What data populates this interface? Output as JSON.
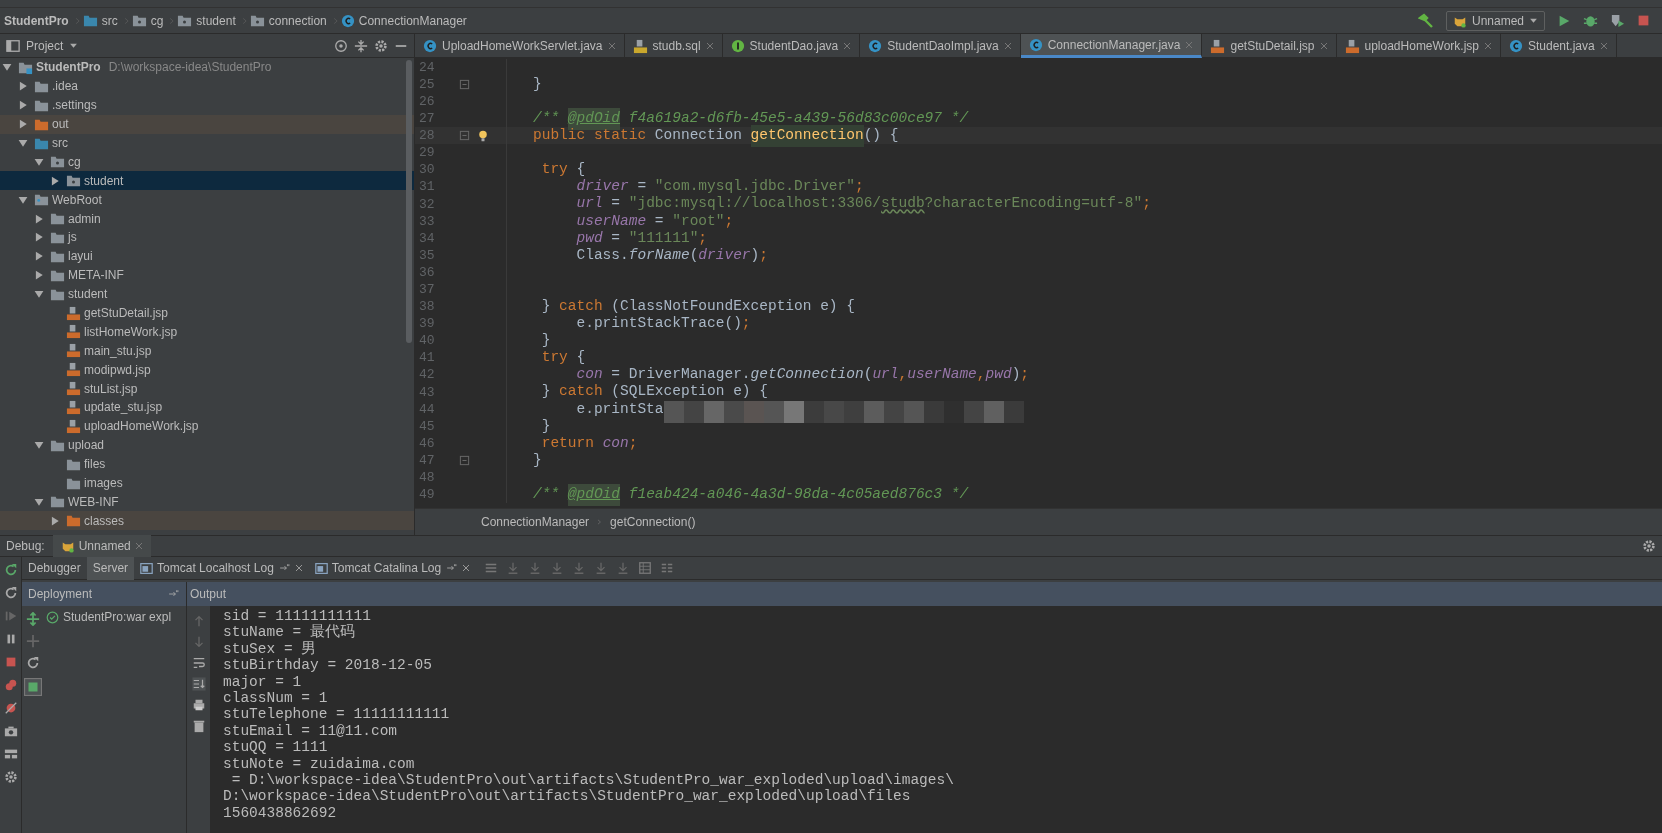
{
  "breadcrumbs": [
    {
      "label": "StudentPro",
      "kind": "module"
    },
    {
      "label": "src",
      "kind": "source"
    },
    {
      "label": "cg",
      "kind": "package"
    },
    {
      "label": "student",
      "kind": "package"
    },
    {
      "label": "connection",
      "kind": "package"
    },
    {
      "label": "ConnectionManager",
      "kind": "class"
    }
  ],
  "run_config": {
    "label": "Unnamed"
  },
  "project_panel": {
    "title": "Project"
  },
  "tabs": [
    {
      "label": "UploadHomeWorkServlet.java",
      "kind": "class",
      "selected": false
    },
    {
      "label": "studb.sql",
      "kind": "sql",
      "selected": false
    },
    {
      "label": "StudentDao.java",
      "kind": "interface",
      "selected": false
    },
    {
      "label": "StudentDaoImpl.java",
      "kind": "class",
      "selected": false
    },
    {
      "label": "ConnectionManager.java",
      "kind": "class",
      "selected": true
    },
    {
      "label": "getStuDetail.jsp",
      "kind": "jsp",
      "selected": false
    },
    {
      "label": "uploadHomeWork.jsp",
      "kind": "jsp",
      "selected": false
    },
    {
      "label": "Student.java",
      "kind": "class",
      "selected": false
    }
  ],
  "tree": [
    {
      "label": "StudentPro",
      "path": "D:\\workspace-idea\\StudentPro",
      "kind": "module",
      "expandable": true,
      "expanded": true,
      "selected": false,
      "children": [
        {
          "label": ".idea",
          "kind": "folder",
          "expandable": true,
          "expanded": false,
          "selected": false
        },
        {
          "label": ".settings",
          "kind": "folder",
          "expandable": true,
          "expanded": false,
          "selected": false
        },
        {
          "label": "out",
          "kind": "excluded",
          "expandable": true,
          "expanded": false,
          "selected": false
        },
        {
          "label": "src",
          "kind": "source",
          "expandable": true,
          "expanded": true,
          "selected": false,
          "children": [
            {
              "label": "cg",
              "kind": "package",
              "expandable": true,
              "expanded": true,
              "selected": false,
              "children": [
                {
                  "label": "student",
                  "kind": "package",
                  "expandable": true,
                  "expanded": false,
                  "selected": true
                }
              ]
            }
          ]
        },
        {
          "label": "WebRoot",
          "kind": "webroot",
          "expandable": true,
          "expanded": true,
          "selected": false,
          "children": [
            {
              "label": "admin",
              "kind": "folder",
              "expandable": true,
              "expanded": false,
              "selected": false
            },
            {
              "label": "js",
              "kind": "folder",
              "expandable": true,
              "expanded": false,
              "selected": false
            },
            {
              "label": "layui",
              "kind": "folder",
              "expandable": true,
              "expanded": false,
              "selected": false
            },
            {
              "label": "META-INF",
              "kind": "folder",
              "expandable": true,
              "expanded": false,
              "selected": false
            },
            {
              "label": "student",
              "kind": "folder",
              "expandable": true,
              "expanded": true,
              "selected": false,
              "children": [
                {
                  "label": "getStuDetail.jsp",
                  "kind": "jsp",
                  "expandable": false,
                  "selected": false
                },
                {
                  "label": "listHomeWork.jsp",
                  "kind": "jsp",
                  "expandable": false,
                  "selected": false
                },
                {
                  "label": "main_stu.jsp",
                  "kind": "jsp",
                  "expandable": false,
                  "selected": false
                },
                {
                  "label": "modipwd.jsp",
                  "kind": "jsp",
                  "expandable": false,
                  "selected": false
                },
                {
                  "label": "stuList.jsp",
                  "kind": "jsp",
                  "expandable": false,
                  "selected": false
                },
                {
                  "label": "update_stu.jsp",
                  "kind": "jsp",
                  "expandable": false,
                  "selected": false
                },
                {
                  "label": "uploadHomeWork.jsp",
                  "kind": "jsp",
                  "expandable": false,
                  "selected": false
                }
              ]
            },
            {
              "label": "upload",
              "kind": "folder",
              "expandable": true,
              "expanded": true,
              "selected": false,
              "children": [
                {
                  "label": "files",
                  "kind": "folder",
                  "expandable": false,
                  "selected": false
                },
                {
                  "label": "images",
                  "kind": "folder",
                  "expandable": false,
                  "selected": false
                }
              ]
            },
            {
              "label": "WEB-INF",
              "kind": "folder",
              "expandable": true,
              "expanded": true,
              "selected": false,
              "children": [
                {
                  "label": "classes",
                  "kind": "excluded",
                  "expandable": true,
                  "expanded": false,
                  "selected": false
                }
              ]
            }
          ]
        }
      ]
    }
  ],
  "code_lines": [
    {
      "number": "24",
      "fold": false,
      "current": false
    },
    {
      "number": "25",
      "fold": true,
      "current": false,
      "tokens": [
        {
          "kind": "plain",
          "text": "}"
        }
      ]
    },
    {
      "number": "26",
      "fold": false,
      "current": false
    },
    {
      "number": "27",
      "fold": false,
      "current": false,
      "tokens": [
        {
          "kind": "comment",
          "text": "/** "
        },
        {
          "kind": "doctag",
          "text": "@pdOid"
        },
        {
          "kind": "comment",
          "text": " f4a619a2-d6fb-45e5-a439-56d83c00ce97 */"
        }
      ]
    },
    {
      "number": "28",
      "fold": true,
      "current": true,
      "tokens": [
        {
          "kind": "keyword",
          "text": "public static "
        },
        {
          "kind": "plain",
          "text": "Connection "
        },
        {
          "kind": "declaration",
          "text": "getConnection"
        },
        {
          "kind": "plain",
          "text": "() {"
        }
      ]
    },
    {
      "number": "29",
      "fold": false,
      "current": false
    },
    {
      "number": "30",
      "fold": false,
      "current": false,
      "tokens": [
        {
          "kind": "keyword",
          "text": " try "
        },
        {
          "kind": "plain",
          "text": "{"
        }
      ]
    },
    {
      "number": "31",
      "fold": false,
      "current": false,
      "tokens": [
        {
          "kind": "field",
          "text": "     driver"
        },
        {
          "kind": "plain",
          "text": " = "
        },
        {
          "kind": "string",
          "text": "\"com.mysql.jdbc.Driver\""
        },
        {
          "kind": "keyword",
          "text": ";"
        }
      ]
    },
    {
      "number": "32",
      "fold": false,
      "current": false,
      "tokens": [
        {
          "kind": "field",
          "text": "     url"
        },
        {
          "kind": "plain",
          "text": " = "
        },
        {
          "kind": "string",
          "text": "\"jdbc:mysql://localhost:3306/"
        },
        {
          "kind": "typo",
          "text": "studb"
        },
        {
          "kind": "string",
          "text": "?characterEncoding=utf-8\""
        },
        {
          "kind": "keyword",
          "text": ";"
        }
      ]
    },
    {
      "number": "33",
      "fold": false,
      "current": false,
      "tokens": [
        {
          "kind": "field",
          "text": "     userName"
        },
        {
          "kind": "plain",
          "text": " = "
        },
        {
          "kind": "string",
          "text": "\"root\""
        },
        {
          "kind": "keyword",
          "text": ";"
        }
      ]
    },
    {
      "number": "34",
      "fold": false,
      "current": false,
      "tokens": [
        {
          "kind": "field",
          "text": "     pwd"
        },
        {
          "kind": "plain",
          "text": " = "
        },
        {
          "kind": "string",
          "text": "\"111111\""
        },
        {
          "kind": "keyword",
          "text": ";"
        }
      ]
    },
    {
      "number": "35",
      "fold": false,
      "current": false,
      "tokens": [
        {
          "kind": "plain",
          "text": "     Class."
        },
        {
          "kind": "method",
          "text": "forName"
        },
        {
          "kind": "plain",
          "text": "("
        },
        {
          "kind": "field",
          "text": "driver"
        },
        {
          "kind": "plain",
          "text": ")"
        },
        {
          "kind": "keyword",
          "text": ";"
        }
      ]
    },
    {
      "number": "36",
      "fold": false,
      "current": false
    },
    {
      "number": "37",
      "fold": false,
      "current": false
    },
    {
      "number": "38",
      "fold": false,
      "current": false,
      "tokens": [
        {
          "kind": "plain",
          "text": " } "
        },
        {
          "kind": "keyword",
          "text": "catch "
        },
        {
          "kind": "plain",
          "text": "(ClassNotFoundException e) {"
        }
      ]
    },
    {
      "number": "39",
      "fold": false,
      "current": false,
      "tokens": [
        {
          "kind": "plain",
          "text": "     e.printStackTrace()"
        },
        {
          "kind": "keyword",
          "text": ";"
        }
      ]
    },
    {
      "number": "40",
      "fold": false,
      "current": false,
      "tokens": [
        {
          "kind": "plain",
          "text": " }"
        }
      ]
    },
    {
      "number": "41",
      "fold": false,
      "current": false,
      "tokens": [
        {
          "kind": "keyword",
          "text": " try "
        },
        {
          "kind": "plain",
          "text": "{"
        }
      ]
    },
    {
      "number": "42",
      "fold": false,
      "current": false,
      "tokens": [
        {
          "kind": "field",
          "text": "     con"
        },
        {
          "kind": "plain",
          "text": " = DriverManager."
        },
        {
          "kind": "method",
          "text": "getConnection"
        },
        {
          "kind": "plain",
          "text": "("
        },
        {
          "kind": "field",
          "text": "url"
        },
        {
          "kind": "keyword",
          "text": ","
        },
        {
          "kind": "field",
          "text": "userName"
        },
        {
          "kind": "keyword",
          "text": ","
        },
        {
          "kind": "field",
          "text": "pwd"
        },
        {
          "kind": "plain",
          "text": ")"
        },
        {
          "kind": "keyword",
          "text": ";"
        }
      ]
    },
    {
      "number": "43",
      "fold": false,
      "current": false,
      "tokens": [
        {
          "kind": "plain",
          "text": " } "
        },
        {
          "kind": "keyword",
          "text": "catch "
        },
        {
          "kind": "plain",
          "text": "(SQLException e) {"
        }
      ]
    },
    {
      "number": "44",
      "fold": false,
      "current": false,
      "tokens": [
        {
          "kind": "plain",
          "text": "     e.printSta"
        },
        {
          "kind": "redacted"
        }
      ]
    },
    {
      "number": "45",
      "fold": false,
      "current": false,
      "tokens": [
        {
          "kind": "plain",
          "text": " }"
        }
      ]
    },
    {
      "number": "46",
      "fold": false,
      "current": false,
      "tokens": [
        {
          "kind": "keyword",
          "text": " return "
        },
        {
          "kind": "field",
          "text": "con"
        },
        {
          "kind": "keyword",
          "text": ";"
        }
      ]
    },
    {
      "number": "47",
      "fold": true,
      "current": false,
      "tokens": [
        {
          "kind": "plain",
          "text": "}"
        }
      ]
    },
    {
      "number": "48",
      "fold": false,
      "current": false
    },
    {
      "number": "49",
      "fold": false,
      "current": false,
      "tokens": [
        {
          "kind": "comment",
          "text": "/** "
        },
        {
          "kind": "doctag",
          "text": "@pdOid"
        },
        {
          "kind": "comment",
          "text": " f1eab424-a046-4a3d-98da-4c05aed876c3 */"
        }
      ]
    }
  ],
  "editor_breadcrumbs": [
    "ConnectionManager",
    "getConnection()"
  ],
  "debug": {
    "label": "Debug:",
    "session": "Unnamed",
    "tabs": [
      {
        "label": "Debugger",
        "kind": "plain",
        "selected": false
      },
      {
        "label": "Server",
        "kind": "plain",
        "selected": true
      },
      {
        "label": "Tomcat Localhost Log",
        "kind": "log",
        "selected": false
      },
      {
        "label": "Tomcat Catalina Log",
        "kind": "log",
        "selected": false
      }
    ],
    "deployment_header": "Deployment",
    "output_header": "Output",
    "deployments": [
      {
        "label": "StudentPro:war expl",
        "deployed": true
      }
    ],
    "output": [
      "sid = 11111111111",
      "stuName = 最代码",
      "stuSex = 男",
      "stuBirthday = 2018-12-05",
      "major = 1",
      "classNum = 1",
      "stuTelephone = 11111111111",
      "stuEmail = 11@11.com",
      "stuQQ = 1111",
      "stuNote = zuidaima.com",
      " = D:\\workspace-idea\\StudentPro\\out\\artifacts\\StudentPro_war_exploded\\upload\\images\\",
      "D:\\workspace-idea\\StudentPro\\out\\artifacts\\StudentPro_war_exploded\\upload\\files",
      "1560438862692"
    ]
  }
}
